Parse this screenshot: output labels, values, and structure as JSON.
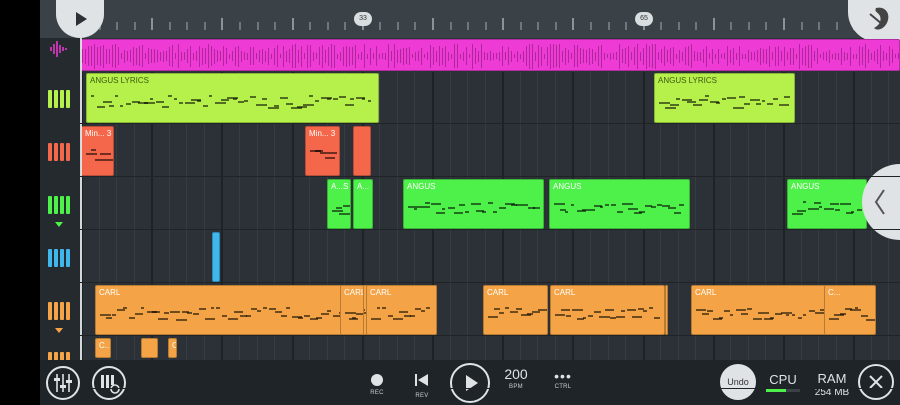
{
  "ruler": {
    "markers": [
      "33",
      "65"
    ]
  },
  "tracks": {
    "audio": {
      "icon": "waveform-icon"
    },
    "clips": [
      {
        "row": 1,
        "title": "ANGUS LYRICS",
        "color": "#b6f04a",
        "text_color": "#3d5a12"
      },
      {
        "row": 1,
        "title": "ANGUS LYRICS",
        "color": "#b6f04a",
        "text_color": "#3d5a12"
      },
      {
        "row": 2,
        "title": "Min... 3",
        "color": "#f4674a",
        "text_color": "#ffffff"
      },
      {
        "row": 2,
        "title": "Min... 3",
        "color": "#f4674a",
        "text_color": "#ffffff"
      },
      {
        "row": 2,
        "title": "",
        "color": "#f4674a",
        "text_color": "#ffffff"
      },
      {
        "row": 3,
        "title": "A...S",
        "color": "#4ef04a",
        "text_color": "#ffffff"
      },
      {
        "row": 3,
        "title": "A...",
        "color": "#4ef04a",
        "text_color": "#ffffff"
      },
      {
        "row": 3,
        "title": "ANGUS",
        "color": "#4ef04a",
        "text_color": "#ffffff"
      },
      {
        "row": 3,
        "title": "ANGUS",
        "color": "#4ef04a",
        "text_color": "#ffffff"
      },
      {
        "row": 3,
        "title": "ANGUS",
        "color": "#4ef04a",
        "text_color": "#ffffff"
      },
      {
        "row": 4,
        "title": "",
        "color": "#3fb6ec",
        "text_color": "#ffffff"
      },
      {
        "row": 5,
        "title": "CARL",
        "color": "#f4a446",
        "text_color": "#ffffff"
      },
      {
        "row": 5,
        "title": "CARL",
        "color": "#f4a446",
        "text_color": "#ffffff"
      },
      {
        "row": 5,
        "title": "CARL",
        "color": "#f4a446",
        "text_color": "#ffffff"
      },
      {
        "row": 5,
        "title": "CARL",
        "color": "#f4a446",
        "text_color": "#ffffff"
      },
      {
        "row": 5,
        "title": "CARL",
        "color": "#f4a446",
        "text_color": "#ffffff"
      },
      {
        "row": 5,
        "title": "CARL",
        "color": "#f4a446",
        "text_color": "#ffffff"
      },
      {
        "row": 5,
        "title": "CARL",
        "color": "#f4a446",
        "text_color": "#ffffff"
      },
      {
        "row": 6,
        "title": "C...",
        "color": "#f4a446",
        "text_color": "#ffffff"
      },
      {
        "row": 6,
        "title": "C...",
        "color": "#f4a446",
        "text_color": "#ffffff"
      },
      {
        "row": 6,
        "title": "",
        "color": "#f4a446",
        "text_color": "#ffffff"
      },
      {
        "row": 6,
        "title": "CA...RT",
        "color": "#f4a446",
        "text_color": "#ffffff"
      }
    ],
    "header_colors": [
      "#ef3bd6",
      "#b6f04a",
      "#f4674a",
      "#4ef04a",
      "#3fb6ec",
      "#f4a446",
      "#f4a446"
    ]
  },
  "toolbar": {
    "mixer_icon": "mixer-icon",
    "piano_settings_icon": "piano-settings-icon",
    "rec_label": "REC",
    "rev_label": "REV",
    "bpm_value": "200",
    "bpm_label": "BPM",
    "ctrl_label": "CTRL",
    "undo_label": "Undo",
    "cpu_label": "CPU",
    "cpu_level": 0.6,
    "ram_label": "RAM",
    "ram_value": "254 MB"
  }
}
